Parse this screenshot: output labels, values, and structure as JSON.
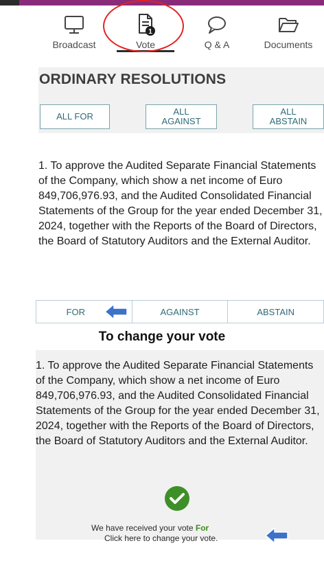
{
  "nav": {
    "tabs": [
      {
        "label": "Broadcast",
        "icon": "monitor-icon"
      },
      {
        "label": "Vote",
        "icon": "document-icon",
        "badge": "1",
        "active": true
      },
      {
        "label": "Q & A",
        "icon": "speech-bubble-icon"
      },
      {
        "label": "Documents",
        "icon": "folder-icon"
      }
    ]
  },
  "section": {
    "title": "ORDINARY RESOLUTIONS",
    "all_for": "ALL FOR",
    "all_against": "ALL\nAGAINST",
    "all_abstain": "ALL\nABSTAIN"
  },
  "resolution": {
    "text": "1. To approve the Audited Separate Financial Statements of the Company, which show a net income of Euro 849,706,976.93, and the Audited Consolidated Financial Statements of the Group for the year ended December 31, 2024, together with the Reports of the Board of Directors, the Board of Statutory Auditors and the External Auditor."
  },
  "vote_options": {
    "for": "FOR",
    "against": "AGAINST",
    "abstain": "ABSTAIN"
  },
  "change_heading": "To change your vote",
  "receipt": {
    "prefix": "We have received your vote",
    "vote": "For",
    "change_link": "Click here to change your vote."
  },
  "colors": {
    "accent": "#2f6b77",
    "highlight_circle": "#e32222",
    "arrow": "#3a73c8",
    "check": "#3f8f28"
  }
}
